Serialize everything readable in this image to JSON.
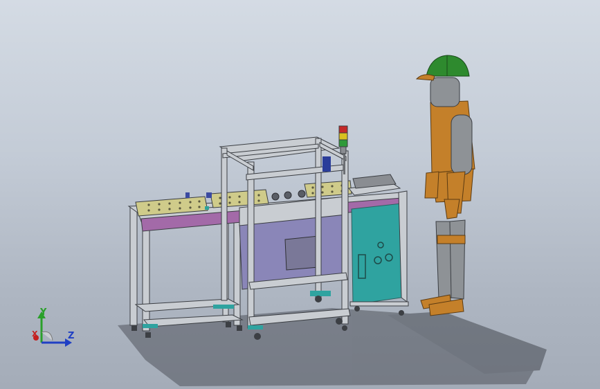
{
  "viewport": {
    "background_top": "#d4dbe4",
    "background_bottom": "#a4acb8"
  },
  "model": {
    "subject": "conveyor-machine-with-operator",
    "frame_color": "#c9cdd2",
    "conveyor_belt_color": "#a36aa8",
    "tray_color": "#cfcb8a",
    "cabinet_color": "#2fa3a0",
    "housing_color": "#8a86b8",
    "operator_body_color": "#c4802a",
    "operator_helmet_color": "#2e8a2e",
    "operator_limb_color": "#8e9296"
  },
  "triad": {
    "y_label": "Y",
    "x_label": "X",
    "z_label": "Z",
    "y_color": "#2aa02a",
    "x_color": "#c42020",
    "z_color": "#1f3fc4"
  }
}
